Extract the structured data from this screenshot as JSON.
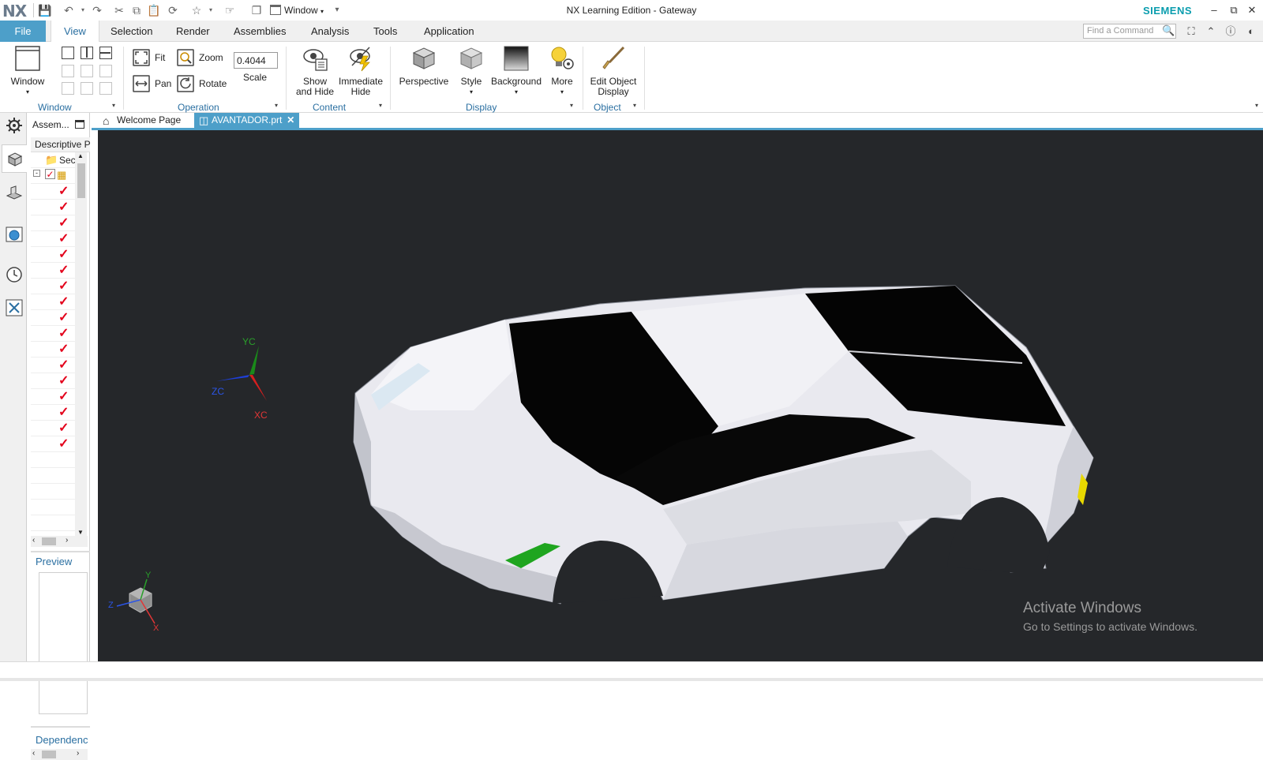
{
  "title_bar": {
    "logo": "NX",
    "window_menu_label": "Window",
    "app_title": "NX Learning Edition - Gateway",
    "brand": "SIEMENS",
    "brand_color": "#0a9dae"
  },
  "menu": {
    "file_label": "File",
    "tabs": [
      "View",
      "Selection",
      "Render",
      "Assemblies",
      "Analysis",
      "Tools",
      "Application"
    ],
    "active_tab": "View",
    "find_placeholder": "Find a Command"
  },
  "ribbon": {
    "window_group": {
      "button_label": "Window",
      "group_label": "Window"
    },
    "operation_group": {
      "fit": "Fit",
      "zoom": "Zoom",
      "pan": "Pan",
      "rotate": "Rotate",
      "scale_value": "0.4044",
      "scale_label": "Scale",
      "group_label": "Operation"
    },
    "content_group": {
      "show_hide_line1": "Show",
      "show_hide_line2": "and Hide",
      "immediate_hide_line1": "Immediate",
      "immediate_hide_line2": "Hide",
      "group_label": "Content"
    },
    "display_group": {
      "perspective": "Perspective",
      "style": "Style",
      "background": "Background",
      "more": "More",
      "group_label": "Display"
    },
    "object_group": {
      "edit_line1": "Edit Object",
      "edit_line2": "Display",
      "group_label": "Object"
    }
  },
  "navigator": {
    "title": "Assem...",
    "column_header": "Descriptive P",
    "section_row": "Sec",
    "preview_label": "Preview",
    "dependencies_label": "Dependenc"
  },
  "doc_tabs": {
    "welcome": "Welcome Page",
    "part": "AVANTADOR.prt"
  },
  "viewport": {
    "background_color": "#25272a",
    "wcs": {
      "x_label": "XC",
      "y_label": "YC",
      "z_label": "ZC"
    },
    "mini_triad": {
      "x": "X",
      "y": "Y",
      "z": "Z"
    },
    "watermark_title": "Activate Windows",
    "watermark_sub": "Go to Settings to activate Windows."
  },
  "accent_color": "#4d9fc9"
}
